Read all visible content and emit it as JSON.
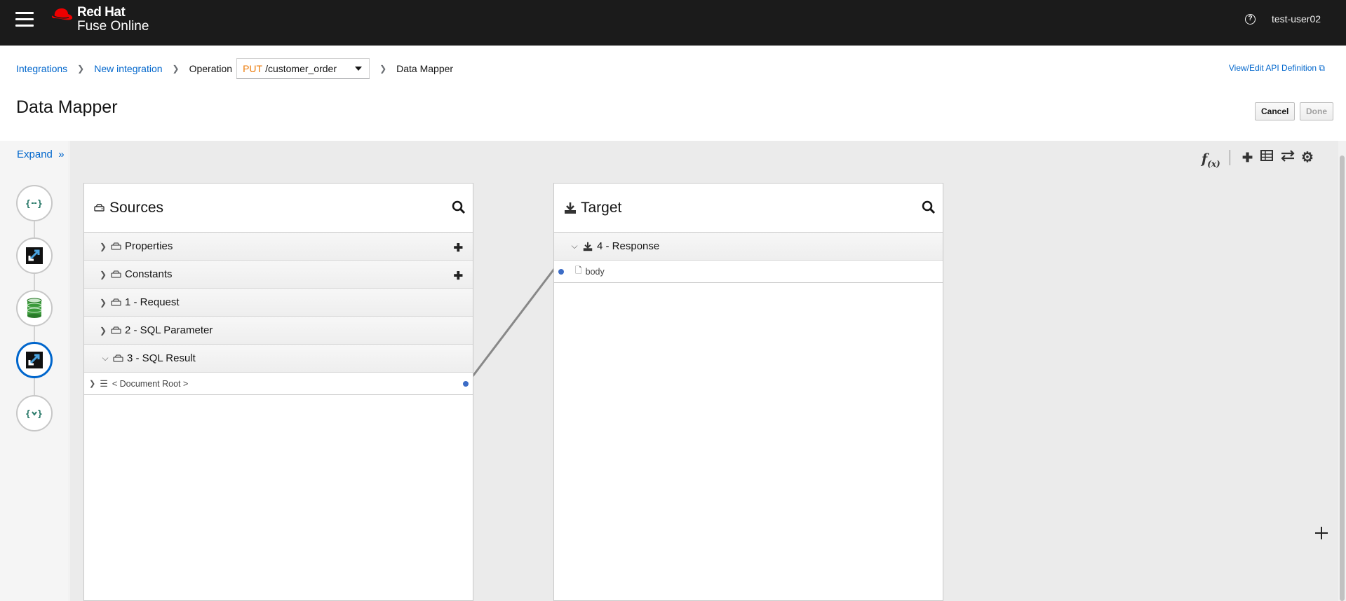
{
  "masthead": {
    "brand_line1": "Red Hat",
    "brand_line2": "Fuse Online",
    "help_icon": "question-circle-icon",
    "user": "test-user02",
    "brand_color": "#ee0000"
  },
  "breadcrumb": {
    "integrations": "Integrations",
    "new_integration": "New integration",
    "operation_label": "Operation",
    "op_method": "PUT",
    "op_path": "/customer_order",
    "data_mapper": "Data Mapper"
  },
  "api_link": "View/Edit API Definition",
  "page_title": "Data Mapper",
  "buttons": {
    "cancel": "Cancel",
    "done": "Done"
  },
  "sidebar": {
    "expand": "Expand",
    "steps": [
      {
        "icon": "api-connector-icon"
      },
      {
        "icon": "data-mapper-icon"
      },
      {
        "icon": "database-icon"
      },
      {
        "icon": "data-mapper-icon",
        "active": true
      },
      {
        "icon": "api-connector-icon"
      }
    ]
  },
  "toolbar": {
    "fx": "f",
    "fx_sub": "(x)",
    "icons": [
      "plus-icon",
      "table-icon",
      "exchange-icon",
      "gear-icon"
    ]
  },
  "sources": {
    "title": "Sources",
    "rows": [
      {
        "label": "Properties",
        "expanded": false,
        "addable": true
      },
      {
        "label": "Constants",
        "expanded": false,
        "addable": true
      },
      {
        "label": "1 - Request",
        "expanded": false,
        "addable": false
      },
      {
        "label": "2 - SQL Parameter",
        "expanded": false,
        "addable": false
      },
      {
        "label": "3 - SQL Result",
        "expanded": true,
        "addable": false
      }
    ],
    "doc_root": "< Document Root >"
  },
  "target": {
    "title": "Target",
    "response": "4 - Response",
    "body": "body"
  },
  "colors": {
    "accent": "#0066cc",
    "method": "#ec7a08",
    "mapping_dot": "#3c6cc6"
  }
}
